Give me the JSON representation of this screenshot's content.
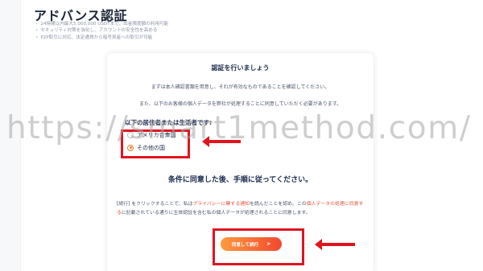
{
  "page": {
    "title": "アドバンス認証",
    "features": [
      "24時間以内最大5,000,000 USDTまで、出金限度額の利用可能",
      "セキュリティ対策を強化し、アカウントの安全性を高める",
      "P2P取引に対応、法定通貨から暗号資産への取引が可能"
    ]
  },
  "card": {
    "title": "認証を行いましょう",
    "line1": "まずは本人確認書類を用意し、それが有効なものであることを確認してください。",
    "line2": "また、以下のお客様の個人データを弊社が処理することに同意していただく必要があります。",
    "residence_label": "以下の居住者または生活者です:",
    "options": [
      {
        "label": "アメリカ合衆国",
        "selected": false
      },
      {
        "label": "その他の国",
        "selected": true
      }
    ],
    "conditions": "条件に同意した後、手順に従ってください。",
    "consent": {
      "part1": "[続行] をクリックすることで、私は",
      "link1": "プライバシーに関する通知",
      "part2": "を読んだことを認め、この",
      "link2": "個人データの処理に同意する",
      "part3": "に記載されている通りに生体認証を含む私の個人データが処理されることに同意します。"
    },
    "button_label": "同意して続行",
    "button_arrow": ">"
  },
  "colors": {
    "accent": "#f07a2d",
    "annotation": "#e01520"
  },
  "watermark": "https://smart1method.com/"
}
